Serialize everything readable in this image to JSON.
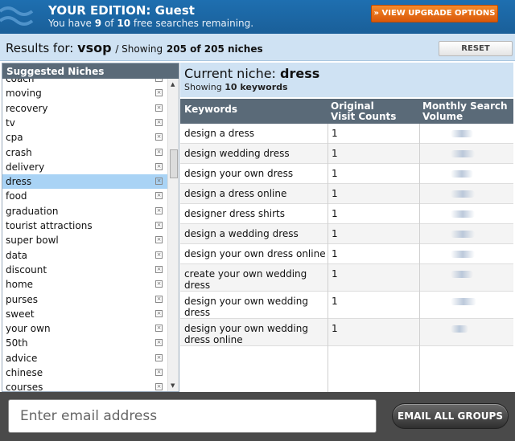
{
  "header": {
    "edition": "YOUR EDITION: Guest",
    "remaining_pre": "You have",
    "remaining_used": "9",
    "remaining_of": "of",
    "remaining_total": "10",
    "remaining_post": "free searches remaining.",
    "upgrade_label": "» VIEW UPGRADE OPTIONS"
  },
  "results": {
    "prefix": "Results for:",
    "keyword": "vsop",
    "sep": "/ Showing",
    "count": "205 of 205 niches",
    "reset_label": "RESET"
  },
  "niches": {
    "header": "Suggested Niches",
    "items": [
      "coach",
      "moving",
      "recovery",
      "tv",
      "cpa",
      "crash",
      "delivery",
      "dress",
      "food",
      "graduation",
      "tourist attractions",
      "super bowl",
      "data",
      "discount",
      "home",
      "purses",
      "sweet",
      "your own",
      "50th",
      "advice",
      "chinese",
      "courses"
    ],
    "active": "dress"
  },
  "current": {
    "prefix": "Current niche:",
    "niche": "dress",
    "showing_pre": "Showing",
    "showing_count": "10 keywords"
  },
  "table": {
    "col_keywords": "Keywords",
    "col_visits_1": "Original",
    "col_visits_2": "Visit Counts",
    "col_volume_1": "Monthly Search",
    "col_volume_2": "Volume",
    "rows": [
      {
        "kw1": "design a dress",
        "kw2": "",
        "visits": "1"
      },
      {
        "kw1": "design wedding dress",
        "kw2": "",
        "visits": "1"
      },
      {
        "kw1": "design your own dress",
        "kw2": "",
        "visits": "1"
      },
      {
        "kw1": "design a dress online",
        "kw2": "",
        "visits": "1"
      },
      {
        "kw1": "designer dress shirts",
        "kw2": "",
        "visits": "1"
      },
      {
        "kw1": "design a wedding dress",
        "kw2": "",
        "visits": "1"
      },
      {
        "kw1": "design your own dress online",
        "kw2": "",
        "visits": "1"
      },
      {
        "kw1": "create your own wedding",
        "kw2": "dress",
        "visits": "1"
      },
      {
        "kw1": "design your own wedding",
        "kw2": "dress",
        "visits": "1"
      },
      {
        "kw1": "design your own wedding",
        "kw2": "dress online",
        "visits": "1"
      }
    ]
  },
  "bottom": {
    "email_placeholder": "Enter email address",
    "email_button": "EMAIL ALL GROUPS"
  }
}
